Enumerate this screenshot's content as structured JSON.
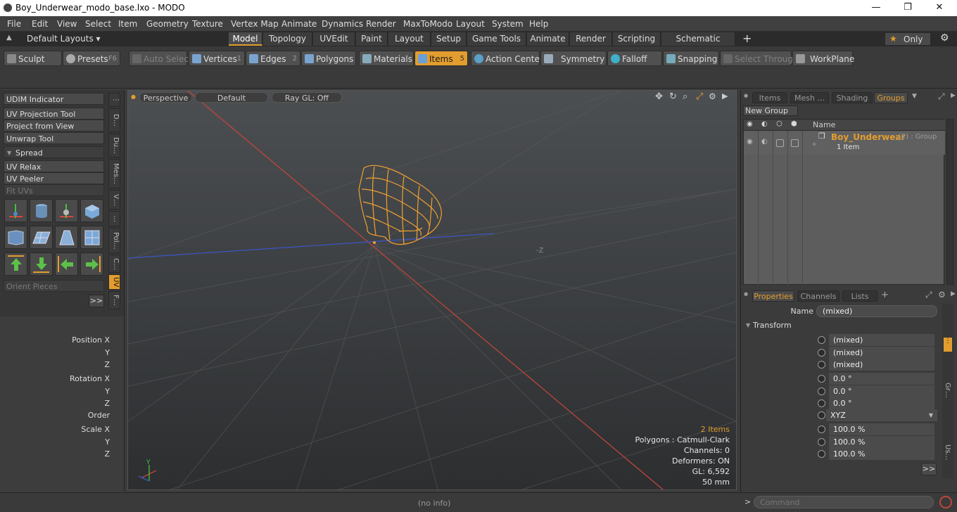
{
  "window": {
    "title": "Boy_Underwear_modo_base.lxo - MODO",
    "minimize": "—",
    "maximize": "❐",
    "close": "✕"
  },
  "menu": [
    "File",
    "Edit",
    "View",
    "Select",
    "Item",
    "Geometry",
    "Texture",
    "Vertex Map",
    "Animate",
    "Dynamics",
    "Render",
    "MaxToModo",
    "Layout",
    "System",
    "Help"
  ],
  "layouts": {
    "selector": "Default Layouts ▾",
    "tabs": [
      "Model",
      "Topology",
      "UVEdit",
      "Paint",
      "Layout",
      "Setup",
      "Game Tools",
      "Animate",
      "Render",
      "Scripting",
      "Schematic Fusion"
    ],
    "active": "Model",
    "add": "+",
    "only": "Only"
  },
  "toolbar": {
    "sculpt": "Sculpt",
    "presets": "Presets",
    "presets_key": "F6",
    "auto_select": "Auto Select",
    "vertices": "Vertices",
    "vertices_key": "1",
    "edges": "Edges",
    "edges_key": "2",
    "polygons": "Polygons",
    "materials": "Materials",
    "items": "Items",
    "items_key": "5",
    "action_center": "Action Center",
    "symmetry": "Symmetry",
    "falloff": "Falloff",
    "snapping": "Snapping",
    "select_through": "Select Through",
    "workplane": "WorkPlane"
  },
  "toolbox": {
    "tools": [
      "UDIM Indicator",
      "UV Projection Tool",
      "Project from View",
      "Unwrap Tool",
      "Spread",
      "UV Relax",
      "UV Peeler",
      "Fit UVs"
    ],
    "orient": "Orient Pieces",
    "more": ">>",
    "vtabs": [
      "D…",
      "Du…",
      "Mes…",
      "V…",
      "…",
      "Pol…",
      "C…",
      "UV",
      "F…"
    ]
  },
  "viewport": {
    "perspective": "Perspective",
    "default": "Default",
    "raygl": "Ray GL: Off",
    "stats": {
      "items": "2 Items",
      "polygons": "Polygons : Catmull-Clark",
      "channels": "Channels: 0",
      "deformers": "Deformers: ON",
      "gl": "GL: 6,592",
      "focal": "50 mm"
    },
    "axis_label": "-Z",
    "axis_y": "Y"
  },
  "groups": {
    "tabs": [
      "Items",
      "Mesh ...",
      "Shading",
      "Groups"
    ],
    "active": "Groups",
    "new_group": "New Group",
    "col_name": "Name",
    "item_name": "Boy_Underwear",
    "item_suffix": "(2) : Group",
    "item_sub": "1 Item"
  },
  "properties": {
    "tabs": [
      "Properties",
      "Channels",
      "Lists"
    ],
    "add": "+",
    "name_label": "Name",
    "name_value": "(mixed)",
    "transform": "Transform",
    "rows": [
      {
        "label": "Position X",
        "value": "(mixed)"
      },
      {
        "label": "Y",
        "value": "(mixed)"
      },
      {
        "label": "Z",
        "value": "(mixed)"
      },
      {
        "label": "Rotation X",
        "value": "0.0 °"
      },
      {
        "label": "Y",
        "value": "0.0 °"
      },
      {
        "label": "Z",
        "value": "0.0 °"
      },
      {
        "label": "Order",
        "value": "XYZ"
      },
      {
        "label": "Scale X",
        "value": "100.0 %"
      },
      {
        "label": "Y",
        "value": "100.0 %"
      },
      {
        "label": "Z",
        "value": "100.0 %"
      }
    ],
    "more": ">>",
    "side_tabs": [
      "Gr…",
      "Us…"
    ]
  },
  "status": {
    "info": "(no info)",
    "command_placeholder": "Command",
    "prompt": ">"
  },
  "colors": {
    "accent": "#e39d2e",
    "axis_x": "#c0453a",
    "axis_z": "#3b55c0"
  }
}
